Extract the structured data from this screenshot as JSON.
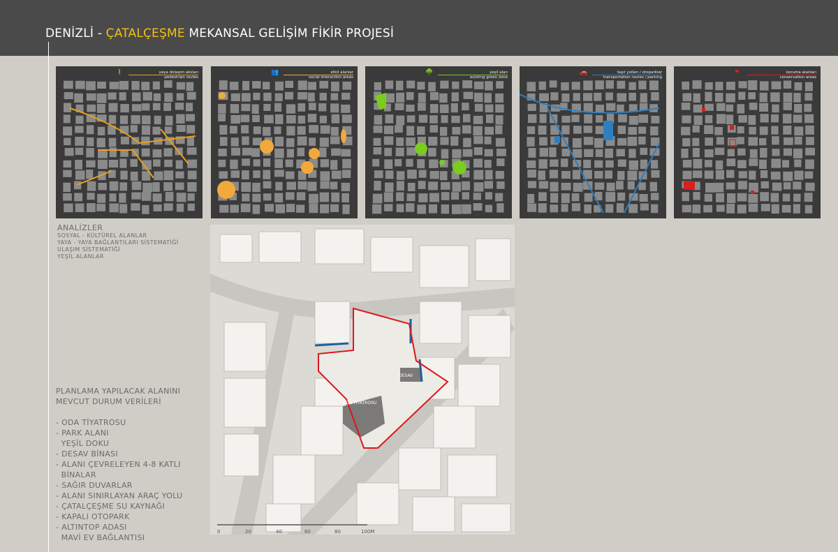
{
  "title": {
    "part1": "DENİZLİ - ",
    "part2": "ÇATALÇEŞME",
    "part3": " MEKANSAL GELİŞİM FİKİR PROJESİ"
  },
  "colors": {
    "pedestrian": "#e8a020",
    "social": "#f2a93b",
    "green": "#7acc1f",
    "transport": "#2f7fbf",
    "conservation": "#d81e1e",
    "site_boundary": "#e0141e",
    "blank_wall": "#1f5fa0"
  },
  "thumbnails": [
    {
      "line1": "yaya dolaşım aksları",
      "line2": "pedestrian routes",
      "icon": "pedestrian-icon"
    },
    {
      "line1": "etkil alanlar",
      "line2": "social interaction areas",
      "icon": "people-icon"
    },
    {
      "line1": "yeşil alan",
      "line2": "existing green zone",
      "icon": "tree-icon"
    },
    {
      "line1": "taşıt yolları / otoparklar",
      "line2": "transportation routes / parking",
      "icon": "car-icon"
    },
    {
      "line1": "koruma alanları",
      "line2": "conservation areas",
      "icon": "flag-icon"
    }
  ],
  "analysis": {
    "heading": "ANALİZLER",
    "items": [
      "SOSYAL - KÜLTÜREL ALANLAR",
      "YAYA - YAYA BAĞLANTILARI SİSTEMATİĞİ",
      "ULAŞIM SİSTEMATİĞİ",
      "YEŞİL ALANLAR"
    ]
  },
  "planning": {
    "heading1": "PLANLAMA YAPILACAK ALANINI",
    "heading2": "MEVCUT DURUM VERİLERİ",
    "items": [
      "- ODA TİYATROSU",
      "- PARK ALANI",
      "  YEŞİL DOKU",
      "- DESAV BİNASI",
      "- ALANI ÇEVRELEYEN 4-8 KATLI",
      "  BİNALAR",
      "- SAĞIR DUVARLAR",
      "- ALANI SINIRLAYAN ARAÇ YOLU",
      "- ÇATALÇEŞME SU KAYNAĞI",
      "- KAPALI OTOPARK",
      "- ALTINTOP ADASI",
      "  MAVİ EV BAĞLANTISI"
    ]
  },
  "map": {
    "label_desav": "DESAV",
    "label_theatre": "ODA TİYATROSU",
    "scale": [
      "0",
      "20",
      "40",
      "60",
      "80",
      "100M"
    ]
  }
}
